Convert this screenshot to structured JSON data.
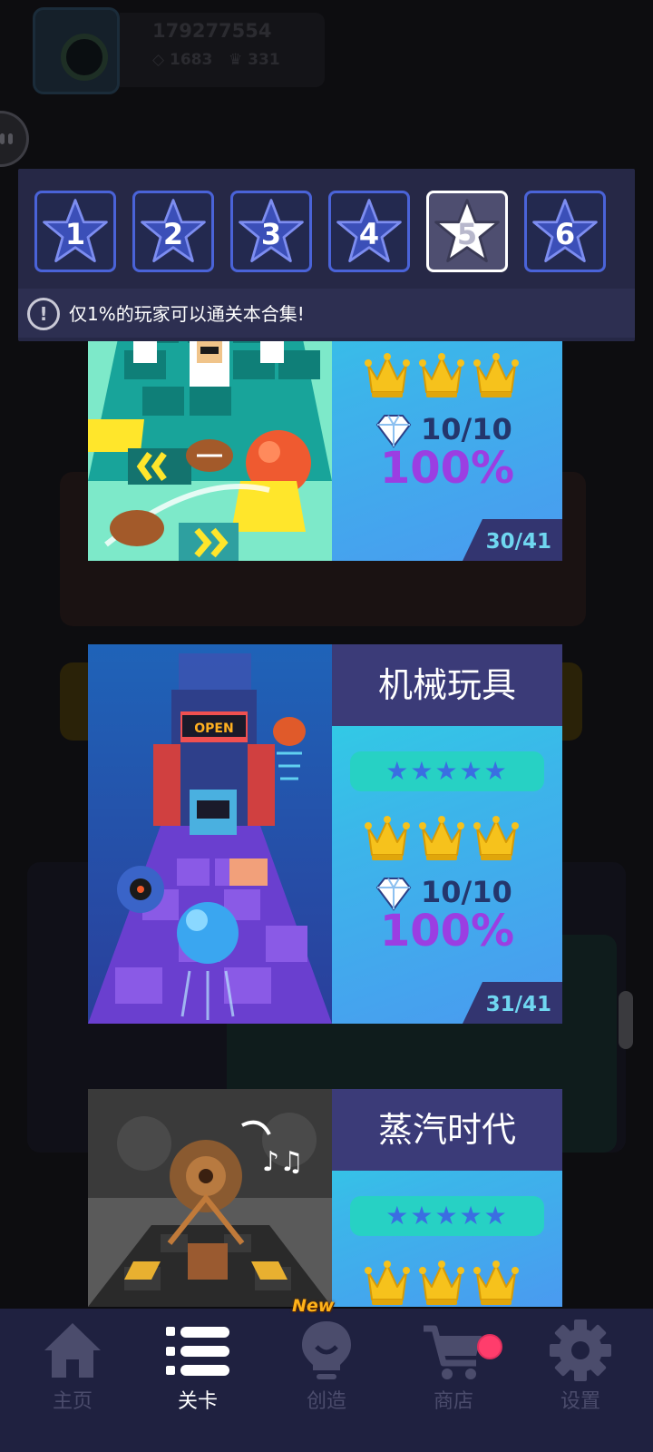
{
  "profile": {
    "user_id": "179277554",
    "gems": "1683",
    "crowns": "331"
  },
  "level_tabs": {
    "tabs": [
      {
        "label": "1",
        "selected": false
      },
      {
        "label": "2",
        "selected": false
      },
      {
        "label": "3",
        "selected": false
      },
      {
        "label": "4",
        "selected": false
      },
      {
        "label": "5",
        "selected": true
      },
      {
        "label": "6",
        "selected": false
      }
    ],
    "notice_icon": "!",
    "notice": "仅1%的玩家可以通关本合集!"
  },
  "levels": [
    {
      "title": "",
      "stars": "★★★★★",
      "crowns": 3,
      "gems": "10/10",
      "progress": "100%",
      "index": "30/41"
    },
    {
      "title": "机械玩具",
      "stars": "★★★★★",
      "crowns": 3,
      "gems": "10/10",
      "progress": "100%",
      "index": "31/41"
    },
    {
      "title": "蒸汽时代",
      "stars": "★★★★★",
      "crowns": 3
    }
  ],
  "nav": {
    "items": [
      {
        "label": "主页",
        "icon": "home-icon",
        "active": false
      },
      {
        "label": "关卡",
        "icon": "list-icon",
        "active": true
      },
      {
        "label": "创造",
        "icon": "bulb-icon",
        "active": false
      },
      {
        "label": "商店",
        "icon": "cart-icon",
        "active": false
      },
      {
        "label": "设置",
        "icon": "gear-icon",
        "active": false
      }
    ],
    "new_badge": "New"
  },
  "colors": {
    "accent_blue": "#4a63d8",
    "card_title_bg": "#3b3b78",
    "percent_purple": "#9b3ee2",
    "nav_bg": "#1f2140",
    "crown_gold": "#f6c21c",
    "badge_red": "#ff3d6c"
  }
}
